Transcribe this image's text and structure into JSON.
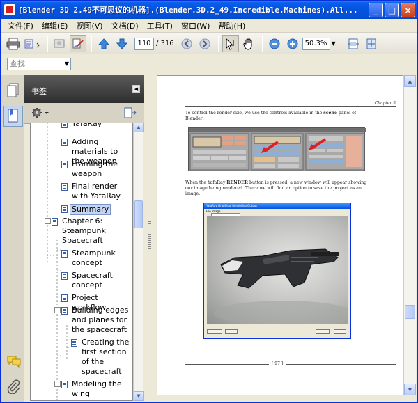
{
  "window": {
    "title": "[Blender 3D 2.49不可思议的机器].(Blender.3D.2_49.Incredible.Machines).All...",
    "min_label": "_",
    "max_label": "□",
    "close_label": "×"
  },
  "menu": [
    "文件(F)",
    "编辑(E)",
    "视图(V)",
    "文档(D)",
    "工具(T)",
    "窗口(W)",
    "帮助(H)"
  ],
  "toolbar": {
    "current_page": "110",
    "total_pages": "/ 316",
    "zoom": "50.3%"
  },
  "search": {
    "placeholder": "查找"
  },
  "bookmarks": {
    "title": "书签",
    "items": [
      {
        "text": "YafaRay",
        "level": 2
      },
      {
        "text": "Adding materials to the weapon",
        "level": 2
      },
      {
        "text": "Framing the weapon",
        "level": 2
      },
      {
        "text": "Final render with YafaRay",
        "level": 2
      },
      {
        "text": "Summary",
        "level": 2
      },
      {
        "text": "Chapter 6: Steampunk Spacecraft",
        "level": 1
      },
      {
        "text": "Steampunk concept",
        "level": 2
      },
      {
        "text": "Spacecraft concept",
        "level": 2
      },
      {
        "text": "Project workflow",
        "level": 2
      },
      {
        "text": "Building edges and planes for the spacecraft",
        "level": 2
      },
      {
        "text": "Creating the first section of the spacecraft",
        "level": 3
      },
      {
        "text": "Modeling the wing",
        "level": 2
      }
    ]
  },
  "document": {
    "chapter": "Chapter 5",
    "para1_a": "To control the render size, we use the controls available in the ",
    "para1_b": "scene",
    "para1_c": " panel of Blender:",
    "para2_a": "When the YafaRay ",
    "para2_b": "RENDER",
    "para2_c": " button is pressed, a new window will appear showing our image being rendered. There we will find an option to save the project as an image:",
    "render_window_title": "YafaRay Graphical Rendering Output",
    "render_menu": "File   Image",
    "page_number": "[ 97 ]"
  }
}
